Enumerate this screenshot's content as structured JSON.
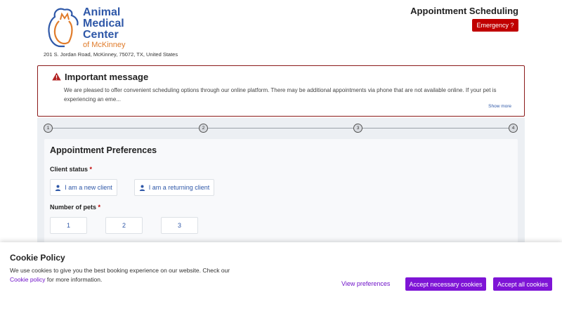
{
  "header": {
    "logo_line1": "Animal",
    "logo_line2": "Medical",
    "logo_line3": "Center",
    "logo_line4": "of McKinney",
    "address": "201 S. Jordan Road, McKinney, 75072, TX, United States",
    "title": "Appointment Scheduling",
    "emergency_label": "Emergency ?"
  },
  "notice": {
    "icon": "warning-triangle-icon",
    "title": "Important message",
    "body": "We are pleased to offer convenient scheduling options through our online platform. There may be additional appointments via phone that are not available online. If your pet is experiencing an eme...",
    "show_more": "Show more"
  },
  "stepper": {
    "steps": [
      "1",
      "2",
      "3",
      "4"
    ]
  },
  "preferences": {
    "title": "Appointment Preferences",
    "client_status_label": "Client status",
    "required_mark": "*",
    "new_client": "I am a new client",
    "returning_client": "I am a returning client",
    "pets_label": "Number of pets",
    "pet_options": [
      "1",
      "2",
      "3"
    ]
  },
  "cookie": {
    "title": "Cookie Policy",
    "text_line1": "We use cookies to give you the best booking experience on our website. Check our",
    "link": "Cookie policy",
    "text_line2": " for more information.",
    "view_prefs": "View preferences",
    "accept_necessary": "Accept necessary cookies",
    "accept_all": "Accept all cookies"
  },
  "colors": {
    "brand_blue": "#2f58a8",
    "brand_orange": "#e07b2a",
    "emergency_red": "#c00000",
    "cookie_purple": "#7e14d6"
  }
}
